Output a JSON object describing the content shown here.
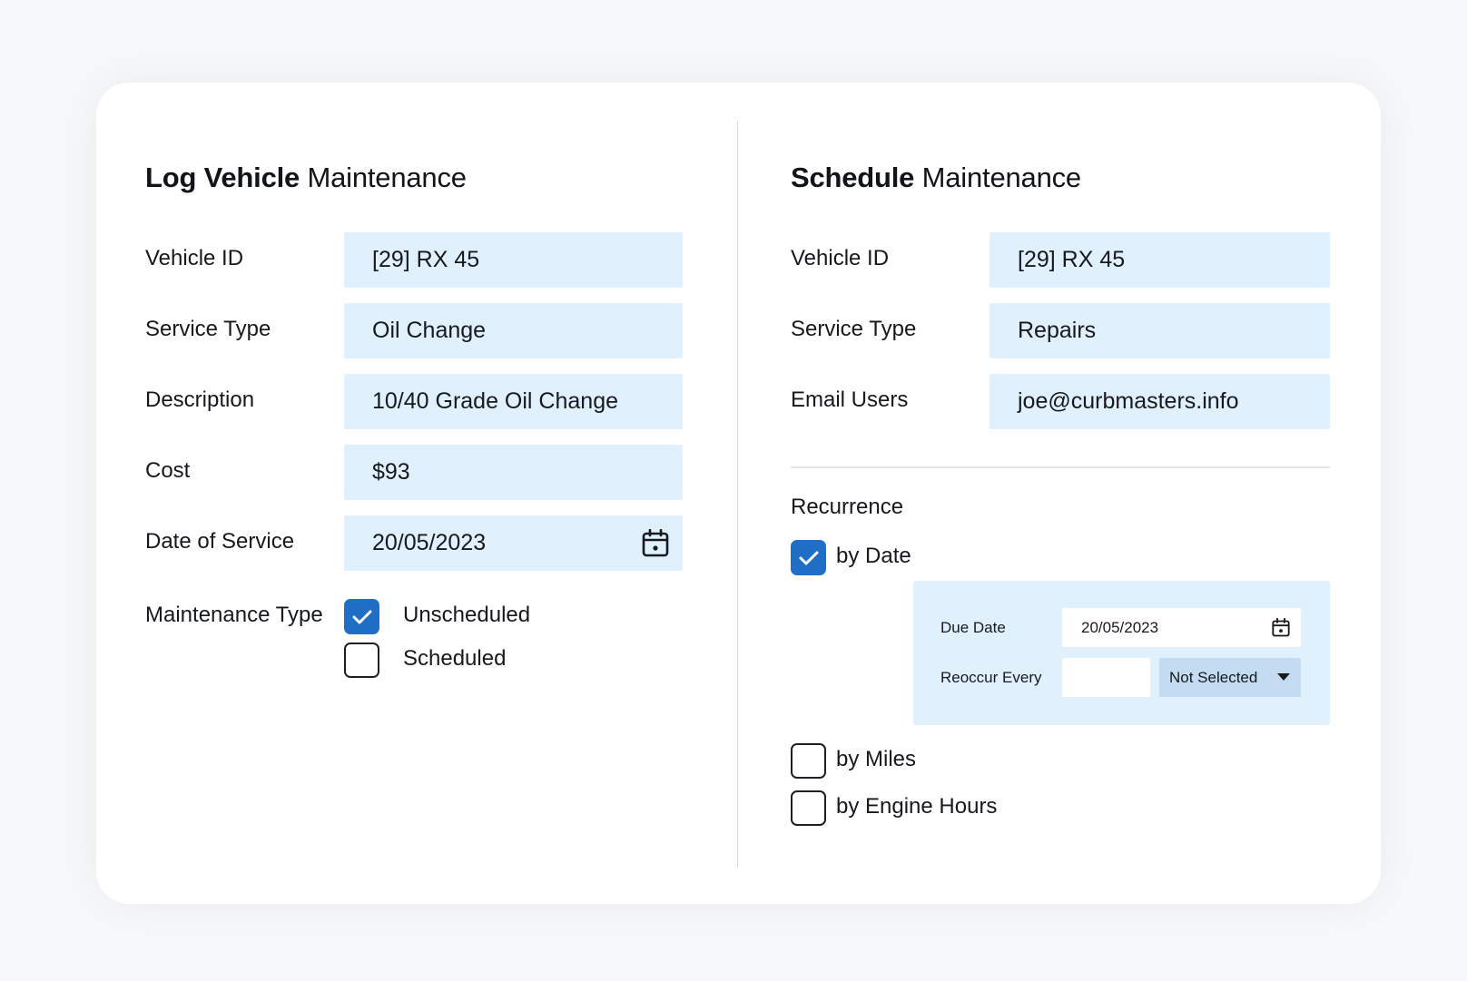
{
  "log_section": {
    "title_bold": "Log Vehicle",
    "title_rest": " Maintenance",
    "vehicle_id": {
      "label": "Vehicle ID",
      "value": "[29] RX 45"
    },
    "service_type": {
      "label": "Service Type",
      "value": "Oil Change"
    },
    "description": {
      "label": "Description",
      "value": "10/40 Grade Oil Change"
    },
    "cost": {
      "label": "Cost",
      "value": "$93"
    },
    "date_of_service": {
      "label": "Date of Service",
      "value": "20/05/2023",
      "icon": "calendar-icon"
    },
    "maintenance_type": {
      "label": "Maintenance Type",
      "options": [
        {
          "label": "Unscheduled",
          "checked": true
        },
        {
          "label": "Scheduled",
          "checked": false
        }
      ]
    }
  },
  "schedule_section": {
    "title_bold": "Schedule",
    "title_rest": " Maintenance",
    "vehicle_id": {
      "label": "Vehicle ID",
      "value": "[29] RX 45"
    },
    "service_type": {
      "label": "Service Type",
      "value": "Repairs"
    },
    "email_users": {
      "label": "Email Users",
      "value": "joe@curbmasters.info"
    },
    "recurrence": {
      "label": "Recurrence",
      "by_date": {
        "label": "by Date",
        "checked": true,
        "due_date": {
          "label": "Due Date",
          "value": "20/05/2023",
          "icon": "calendar-icon"
        },
        "reoccur_every": {
          "label": "Reoccur Every",
          "value": "",
          "unit": "Not Selected",
          "icon": "caret-down-icon"
        }
      },
      "by_miles": {
        "label": "by Miles",
        "checked": false
      },
      "by_engine_hours": {
        "label": "by Engine Hours",
        "checked": false
      }
    }
  },
  "colors": {
    "field_bg": "#e1f0fd",
    "checkbox_checked": "#1f6fc6",
    "select_bg": "#c4dcf1",
    "text": "#16191d"
  }
}
